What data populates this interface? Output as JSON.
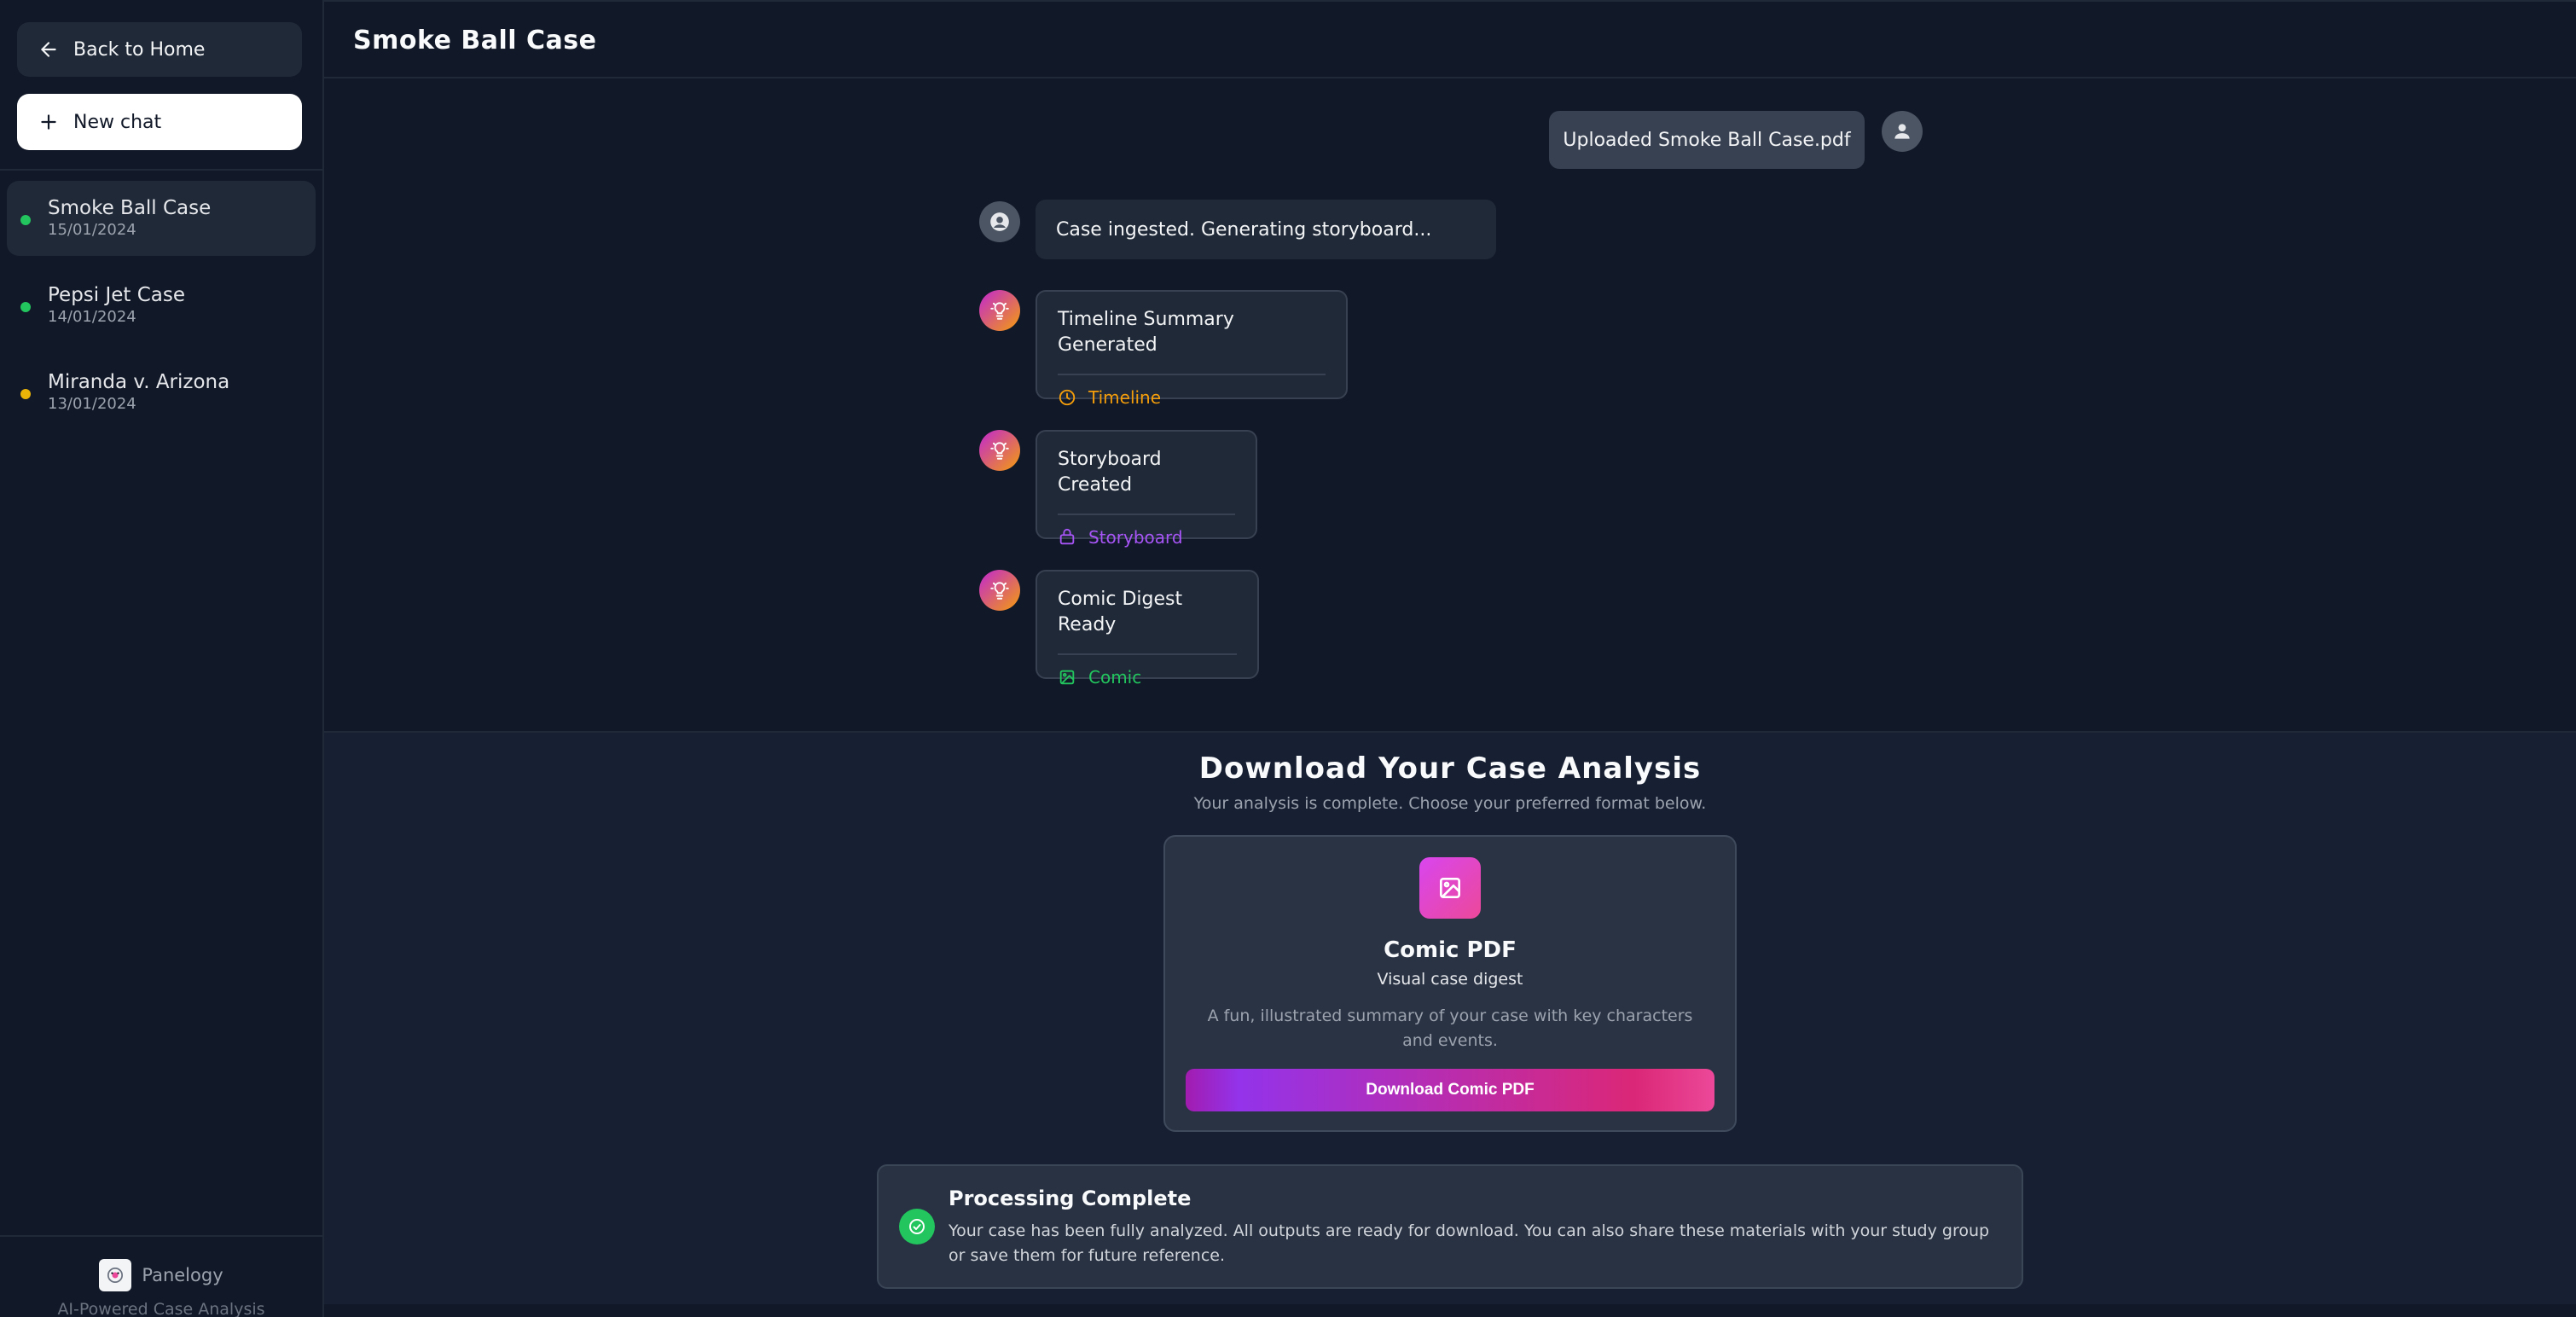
{
  "sidebar": {
    "back_label": "Back to Home",
    "new_chat_label": "New chat",
    "chats": [
      {
        "title": "Smoke Ball Case",
        "date": "15/01/2024",
        "status_color": "#22c55e",
        "active": true
      },
      {
        "title": "Pepsi Jet Case",
        "date": "14/01/2024",
        "status_color": "#22c55e",
        "active": false
      },
      {
        "title": "Miranda v. Arizona",
        "date": "13/01/2024",
        "status_color": "#eab308",
        "active": false
      }
    ],
    "brand_name": "Panelogy",
    "brand_tagline": "AI-Powered Case Analysis"
  },
  "header": {
    "title": "Smoke Ball Case"
  },
  "messages": {
    "user_upload": "Uploaded Smoke Ball Case.pdf",
    "system_status": "Case ingested. Generating storyboard...",
    "cards": [
      {
        "title": "Timeline Summary Generated",
        "link_label": "Timeline",
        "link_icon": "clock-icon",
        "color": "#f59e0b"
      },
      {
        "title": "Storyboard Created",
        "link_label": "Storyboard",
        "link_icon": "storyboard-icon",
        "color": "#a855f7"
      },
      {
        "title": "Comic Digest Ready",
        "link_label": "Comic",
        "link_icon": "image-icon",
        "color": "#22c55e"
      }
    ]
  },
  "download": {
    "title": "Download Your Case Analysis",
    "subtitle": "Your analysis is complete. Choose your preferred format below.",
    "card": {
      "title": "Comic PDF",
      "subtitle": "Visual case digest",
      "description": "A fun, illustrated summary of your case with key characters and events.",
      "button_label": "Download Comic PDF"
    }
  },
  "status": {
    "title": "Processing Complete",
    "text": "Your case has been fully analyzed. All outputs are ready for download. You can also share these materials with your study group or save them for future reference."
  },
  "colors": {
    "background": "#111827",
    "accent_pink": "#ec4899",
    "accent_purple": "#9333ea",
    "success": "#22c55e"
  }
}
